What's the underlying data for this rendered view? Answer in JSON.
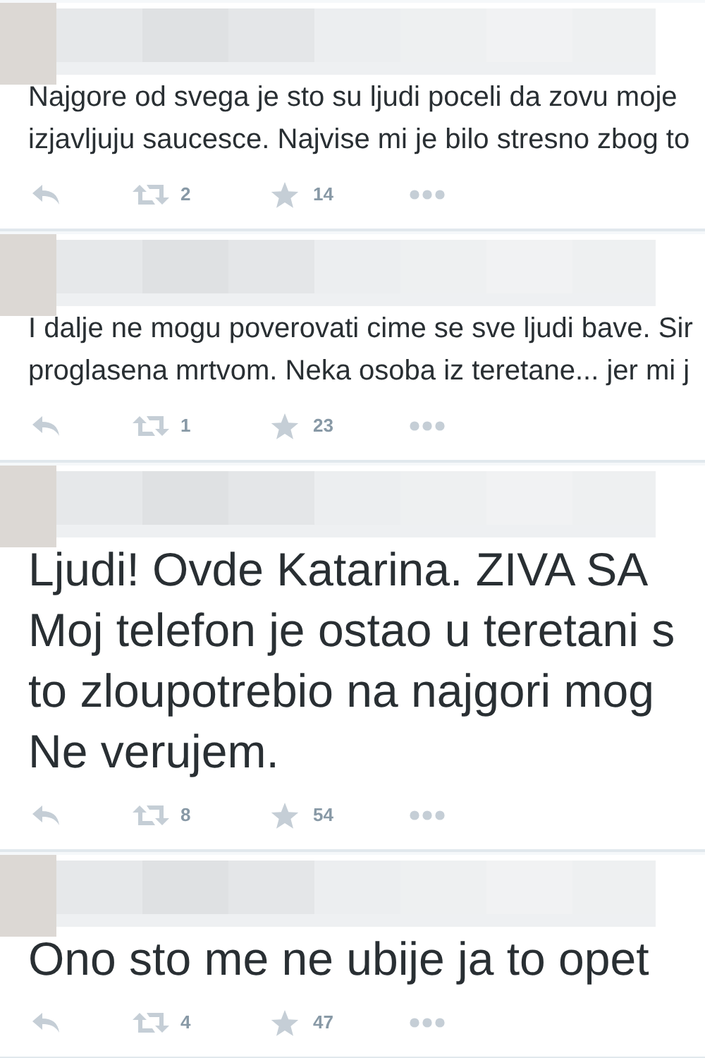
{
  "tweets": [
    {
      "kind": "normal",
      "lines": [
        "Najgore od svega je sto su ljudi poceli da zovu moje",
        "izjavljuju saucesce. Najvise mi je bilo stresno zbog to"
      ],
      "retweets": "2",
      "favorites": "14"
    },
    {
      "kind": "normal",
      "lines": [
        "I dalje ne mogu poverovati cime se sve ljudi bave. Sir",
        "proglasena mrtvom. Neka osoba iz teretane... jer mi j"
      ],
      "retweets": "1",
      "favorites": "23"
    },
    {
      "kind": "large",
      "lines": [
        "Ljudi! Ovde Katarina. ZIVA SA",
        "Moj telefon je ostao u teretani s",
        "to zloupotrebio na najgori mog",
        "Ne verujem."
      ],
      "retweets": "8",
      "favorites": "54"
    },
    {
      "kind": "large",
      "lines": [
        "Ono sto me ne ubije ja to opet"
      ],
      "retweets": "4",
      "favorites": "47"
    }
  ]
}
